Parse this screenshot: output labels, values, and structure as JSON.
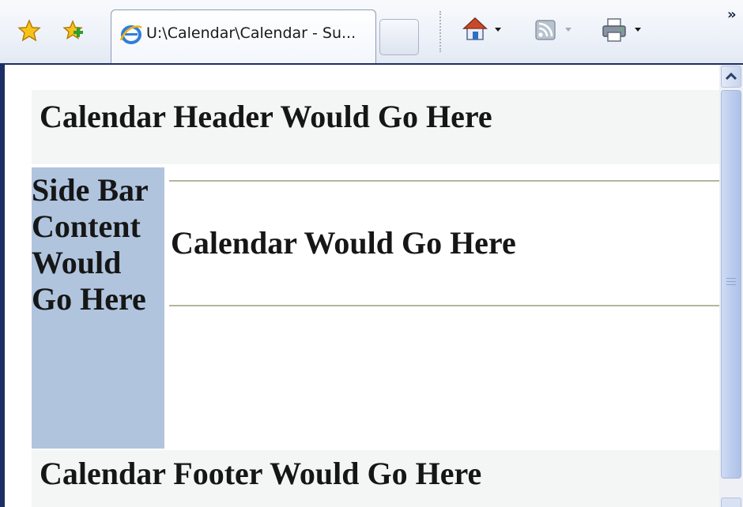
{
  "browser": {
    "tab_title": "U:\\Calendar\\Calendar - Su...",
    "more_chevron": "»",
    "icons": {
      "favorites": "favorites-star-icon",
      "add_favorites": "add-favorites-icon",
      "tab_page": "ie-page-icon",
      "home": "home-icon",
      "feeds": "feeds-icon",
      "print": "print-icon"
    },
    "colors": {
      "frame": "#1d2e64",
      "toolbar": "#eef2f9",
      "scroll_thumb": "#bccdee"
    }
  },
  "page": {
    "header_text": "Calendar Header Would Go Here",
    "sidebar_text": "Side Bar Content Would Go Here",
    "main_text": "Calendar Would Go Here",
    "footer_text": "Calendar Footer Would Go Here",
    "colors": {
      "header_bg": "#f4f5f5",
      "sidebar_bg": "#b0c4de",
      "rule": "#b7b59c",
      "text": "#161616"
    }
  }
}
